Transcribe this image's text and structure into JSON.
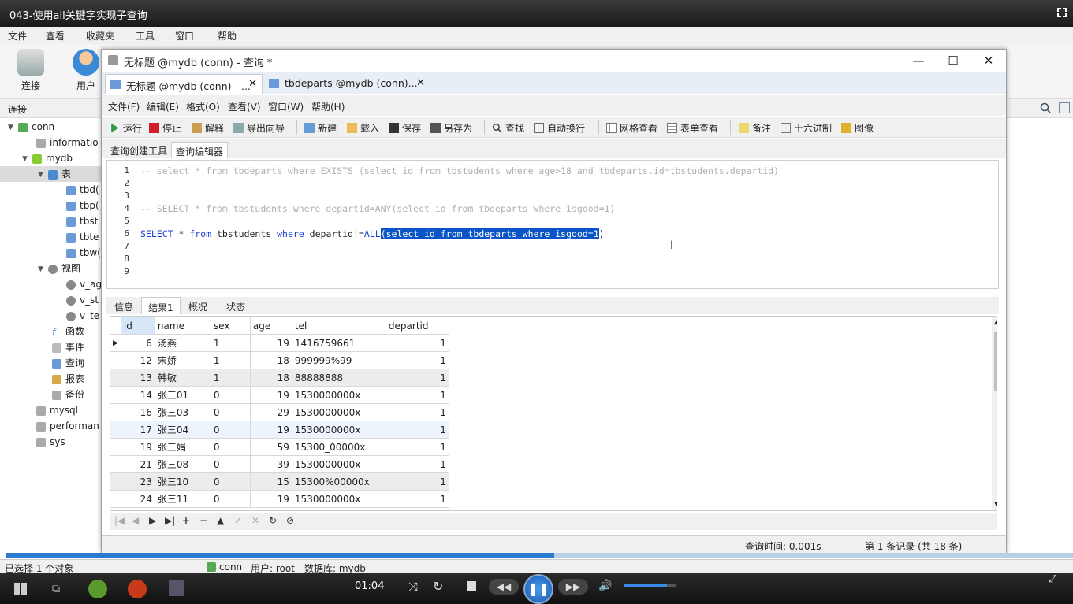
{
  "player": {
    "title": "043-使用all关键字实现子查询",
    "time": "01:04",
    "progress": 0.514,
    "volume": 0.82
  },
  "outer_menu": [
    "文件",
    "查看",
    "收藏夹",
    "工具",
    "窗口",
    "帮助"
  ],
  "outer_toolbar": {
    "connect": "连接",
    "user": "用户"
  },
  "connection_header": "连接",
  "tree": {
    "conn": "conn",
    "information": "informatio",
    "mydb": "mydb",
    "tables": "表",
    "table_items": [
      "tbd(",
      "tbp(",
      "tbst",
      "tbte",
      "tbw("
    ],
    "views": "视图",
    "view_items": [
      "v_ag",
      "v_st",
      "v_te"
    ],
    "functions": "函数",
    "events": "事件",
    "queries": "查询",
    "reports": "报表",
    "backups": "备份",
    "mysql": "mysql",
    "performance": "performan",
    "sys": "sys"
  },
  "window": {
    "title": "无标题 @mydb (conn) - 查询 *",
    "tabs": [
      "无标题 @mydb (conn) - ...",
      "tbdeparts @mydb (conn)..."
    ]
  },
  "inner_menu": [
    "文件(F)",
    "编辑(E)",
    "格式(O)",
    "查看(V)",
    "窗口(W)",
    "帮助(H)"
  ],
  "inner_toolbar": {
    "run": "运行",
    "stop": "停止",
    "explain": "解释",
    "export": "导出向导",
    "new": "新建",
    "load": "载入",
    "save": "保存",
    "save_as": "另存为",
    "find": "查找",
    "word_wrap": "自动换行",
    "grid_view": "网格查看",
    "form_view": "表单查看",
    "memo": "备注",
    "hex": "十六进制",
    "image": "图像"
  },
  "sub_tabs": [
    "查询创建工具",
    "查询编辑器"
  ],
  "editor": {
    "line_numbers": [
      "1",
      "2",
      "3",
      "4",
      "5",
      "6",
      "7",
      "8",
      "9"
    ],
    "line1": "-- select * from tbdeparts where EXISTS (select id from tbstudents where age>18 and tbdeparts.id=tbstudents.departid)",
    "line4": "-- SELECT * from tbstudents where departid=ANY(select id from tbdeparts where isgood=1)",
    "line6_kw1": "SELECT",
    "line6_a": " * ",
    "line6_kw2": "from",
    "line6_b": " tbstudents ",
    "line6_kw3": "where",
    "line6_c": " departid!=",
    "line6_kw4": "ALL",
    "line6_sel": "(select id from tbdeparts where isgood=1",
    "line6_end": ")"
  },
  "result_tabs": [
    "信息",
    "结果1",
    "概况",
    "状态"
  ],
  "grid": {
    "columns": [
      "id",
      "name",
      "sex",
      "age",
      "tel",
      "departid"
    ],
    "rows": [
      [
        "6",
        "汤燕",
        "1",
        "19",
        "1416759661",
        "1"
      ],
      [
        "12",
        "宋娇",
        "1",
        "18",
        "999999%99",
        "1"
      ],
      [
        "13",
        "韩敏",
        "1",
        "18",
        "88888888",
        "1"
      ],
      [
        "14",
        "张三01",
        "0",
        "19",
        "1530000000x",
        "1"
      ],
      [
        "16",
        "张三03",
        "0",
        "29",
        "1530000000x",
        "1"
      ],
      [
        "17",
        "张三04",
        "0",
        "19",
        "1530000000x",
        "1"
      ],
      [
        "19",
        "张三娟",
        "0",
        "59",
        "15300_00000x",
        "1"
      ],
      [
        "21",
        "张三08",
        "0",
        "39",
        "1530000000x",
        "1"
      ],
      [
        "23",
        "张三10",
        "0",
        "15",
        "15300%00000x",
        "1"
      ],
      [
        "24",
        "张三11",
        "0",
        "19",
        "1530000000x",
        "1"
      ]
    ]
  },
  "status": {
    "query_time": "查询时间: 0.001s",
    "record": "第 1 条记录 (共 18 条)"
  },
  "outer_status": {
    "selected": "已选择 1 个对象",
    "conn": "conn",
    "user": "用户: root",
    "db": "数据库: mydb"
  }
}
